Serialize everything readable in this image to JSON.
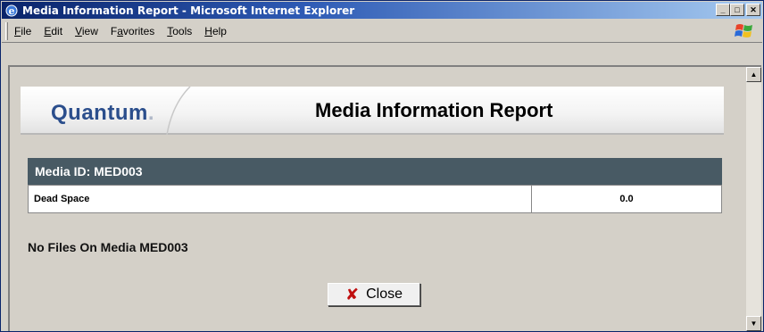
{
  "window": {
    "title": "Media Information Report - Microsoft Internet Explorer",
    "controls": {
      "minimize": "_",
      "maximize": "□",
      "close": "✕"
    }
  },
  "menu": [
    {
      "label": "File",
      "accel": "F",
      "rest": "ile"
    },
    {
      "label": "Edit",
      "accel": "E",
      "rest": "dit"
    },
    {
      "label": "View",
      "accel": "V",
      "rest": "iew"
    },
    {
      "label": "Favorites",
      "accel": "a",
      "pre": "F",
      "rest": "vorites"
    },
    {
      "label": "Tools",
      "accel": "T",
      "rest": "ools"
    },
    {
      "label": "Help",
      "accel": "H",
      "rest": "elp"
    }
  ],
  "header": {
    "logo_text": "Quantum",
    "logo_dot": ".",
    "report_title": "Media Information Report"
  },
  "media": {
    "header": "Media ID: MED003",
    "rows": [
      {
        "label": "Dead Space",
        "value": "0.0"
      }
    ]
  },
  "message": "No Files On Media MED003",
  "close_button": {
    "label": "Close",
    "icon": "close-x-icon"
  },
  "colors": {
    "title_bar": "#0a246a",
    "media_header_bg": "#485a64",
    "logo": "#2b4e8c",
    "close_icon": "#c01010"
  }
}
